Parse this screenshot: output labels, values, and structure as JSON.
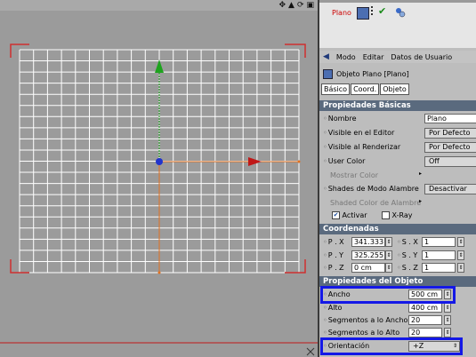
{
  "viewport": {
    "icons": [
      "move-icon",
      "triangle-icon",
      "rotate-icon",
      "maximize-icon"
    ],
    "icon_glyphs": [
      "✥",
      "▲",
      "⟳",
      "▣"
    ]
  },
  "object_manager": {
    "object_name": "Plano"
  },
  "attributes": {
    "menu": [
      "Modo",
      "Editar",
      "Datos de Usuario"
    ],
    "object_label": "Objeto Plano [Plano]",
    "tabs": [
      "Básico",
      "Coord.",
      "Objeto"
    ],
    "basic": {
      "title": "Propiedades Básicas",
      "nombre_label": "Nombre",
      "nombre_value": "Plano",
      "visible_editor_label": "Visible en el Editor",
      "visible_editor_value": "Por Defecto",
      "visible_render_label": "Visible al Renderizar",
      "visible_render_value": "Por Defecto",
      "user_color_label": "User Color",
      "user_color_value": "Off",
      "mostrar_color_label": "Mostrar Color",
      "shades_label": "Shades de Modo Alambre",
      "shades_value": "Desactivar",
      "shaded_color_label": "Shaded Color de Alambre",
      "activar_label": "Activar",
      "xray_label": "X-Ray"
    },
    "coords": {
      "title": "Coordenadas",
      "px_label": "P . X",
      "px_value": "341.333 c",
      "py_label": "P . Y",
      "py_value": "325.255 c",
      "pz_label": "P . Z",
      "pz_value": "0 cm",
      "sx_label": "S . X",
      "sx_value": "1",
      "sy_label": "S . Y",
      "sy_value": "1",
      "sz_label": "S . Z",
      "sz_value": "1"
    },
    "object": {
      "title": "Propiedades del Objeto",
      "ancho_label": "Ancho",
      "ancho_value": "500 cm",
      "alto_label": "Alto",
      "alto_value": "400 cm",
      "seg_ancho_label": "Segmentos a lo Ancho",
      "seg_ancho_value": "20",
      "seg_alto_label": "Segmentos a lo Alto",
      "seg_alto_value": "20",
      "orient_label": "Orientación",
      "orient_value": "+Z"
    }
  },
  "colors": {
    "highlight": "#1418e6",
    "section": "#5a6a7e",
    "axis_y": "#1ea31e",
    "axis_x": "#c01818",
    "origin": "#2233cc"
  }
}
